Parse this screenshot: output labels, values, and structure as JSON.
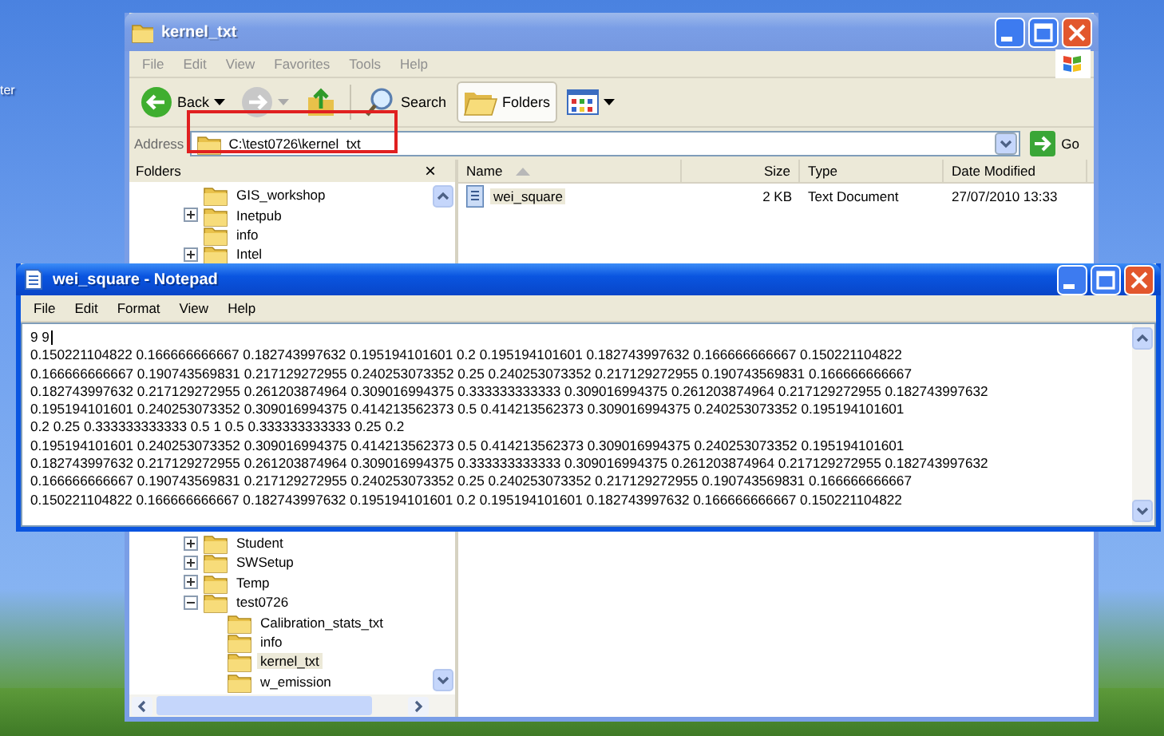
{
  "desktop": {
    "icon_labels": [
      "ter"
    ]
  },
  "explorer": {
    "title": "kernel_txt",
    "active": false,
    "menu": [
      "File",
      "Edit",
      "View",
      "Favorites",
      "Tools",
      "Help"
    ],
    "toolbar": [
      {
        "kind": "back",
        "label": "Back",
        "pressed": false
      },
      {
        "kind": "forward",
        "pressed": false
      },
      {
        "kind": "up",
        "pressed": false
      },
      {
        "kind": "search",
        "label": "Search",
        "pressed": false
      },
      {
        "kind": "folders",
        "label": "Folders",
        "pressed": true
      },
      {
        "kind": "views",
        "pressed": false
      }
    ],
    "address": {
      "label": "Address",
      "value": "C:\\test0726\\kernel_txt",
      "go": "Go"
    },
    "folders_pane": {
      "title": "Folders",
      "close": "×",
      "items_upper": [
        {
          "label": "GIS_workshop",
          "selected": false
        },
        {
          "label": "Inetpub",
          "expanded": false,
          "selected": false
        },
        {
          "label": "info",
          "selected": false
        },
        {
          "label": "Intel",
          "expanded": false,
          "selected": false
        }
      ],
      "items_lower": [
        {
          "label": "Student",
          "expanded": false,
          "selected": false
        },
        {
          "label": "SWSetup",
          "expanded": false,
          "selected": false
        },
        {
          "label": "Temp",
          "expanded": false,
          "selected": false
        },
        {
          "label": "test0726",
          "expanded": true,
          "selected": false,
          "children": [
            {
              "label": "Calibration_stats_txt",
              "selected": false
            },
            {
              "label": "info",
              "selected": false
            },
            {
              "label": "kernel_txt",
              "selected": true
            },
            {
              "label": "w_emission",
              "selected": false
            }
          ]
        }
      ]
    },
    "file_list": {
      "columns": [
        {
          "label": "Name",
          "sorted": true
        },
        {
          "label": "Size"
        },
        {
          "label": "Type"
        },
        {
          "label": "Date Modified"
        }
      ],
      "rows": [
        {
          "name": "wei_square",
          "size": "2 KB",
          "type": "Text Document",
          "modified": "27/07/2010 13:33",
          "selected": true
        }
      ]
    }
  },
  "notepad": {
    "title": "wei_square - Notepad",
    "active": true,
    "menu": [
      "File",
      "Edit",
      "Format",
      "View",
      "Help"
    ],
    "lines": [
      "9 9",
      "0.150221104822 0.166666666667 0.182743997632 0.195194101601 0.2 0.195194101601 0.182743997632 0.166666666667 0.150221104822",
      "0.166666666667 0.190743569831 0.217129272955 0.240253073352 0.25 0.240253073352 0.217129272955 0.190743569831 0.166666666667",
      "0.182743997632 0.217129272955 0.261203874964 0.309016994375 0.333333333333 0.309016994375 0.261203874964 0.217129272955 0.182743997632",
      "0.195194101601 0.240253073352 0.309016994375 0.414213562373 0.5 0.414213562373 0.309016994375 0.240253073352 0.195194101601",
      "0.2 0.25 0.333333333333 0.5 1 0.5 0.333333333333 0.25 0.2",
      "0.195194101601 0.240253073352 0.309016994375 0.414213562373 0.5 0.414213562373 0.309016994375 0.240253073352 0.195194101601",
      "0.182743997632 0.217129272955 0.261203874964 0.309016994375 0.333333333333 0.309016994375 0.261203874964 0.217129272955 0.182743997632",
      "0.166666666667 0.190743569831 0.217129272955 0.240253073352 0.25 0.240253073352 0.217129272955 0.190743569831 0.166666666667",
      "0.150221104822 0.166666666667 0.182743997632 0.195194101601 0.2 0.195194101601 0.182743997632 0.166666666667 0.150221104822"
    ]
  }
}
